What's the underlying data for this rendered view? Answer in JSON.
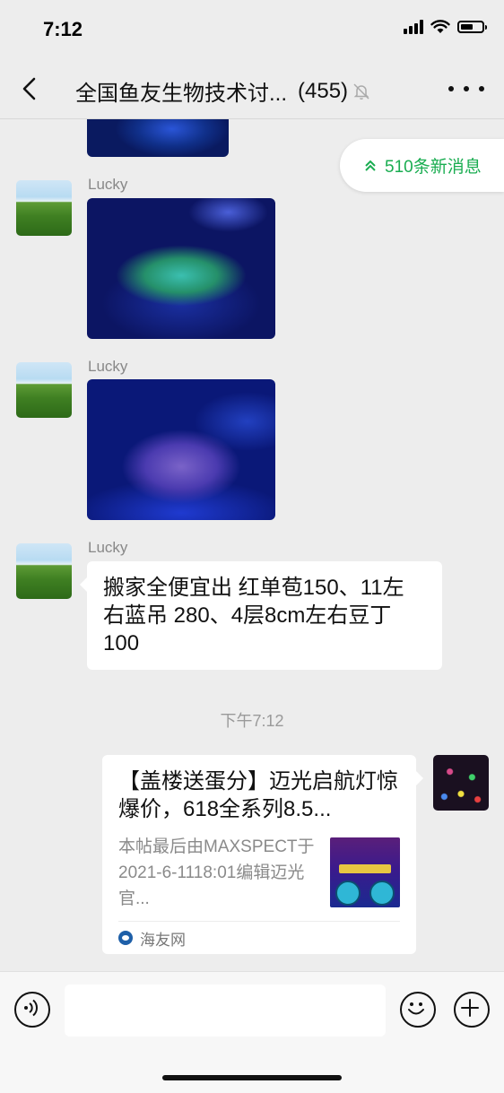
{
  "status_bar": {
    "time": "7:12",
    "battery_level": 0.6
  },
  "nav": {
    "title": "全国鱼友生物技术讨...",
    "count": "(455)",
    "muted": true
  },
  "new_messages": {
    "label": "510条新消息"
  },
  "messages": [
    {
      "type": "image",
      "sender": "",
      "partial": true
    },
    {
      "type": "image",
      "sender": "Lucky"
    },
    {
      "type": "image",
      "sender": "Lucky"
    },
    {
      "type": "text",
      "sender": "Lucky",
      "text": "搬家全便宜出 红单苞150、11左右蓝吊 280、4层8cm左右豆丁100"
    }
  ],
  "timestamp": "下午7:12",
  "link_card": {
    "title": "【盖楼送蛋分】迈光启航灯惊爆价，618全系列8.5...",
    "description": "本帖最后由MAXSPECT于2021-6-1118:01编辑迈光官...",
    "source": "海友网"
  },
  "input": {
    "placeholder": ""
  }
}
